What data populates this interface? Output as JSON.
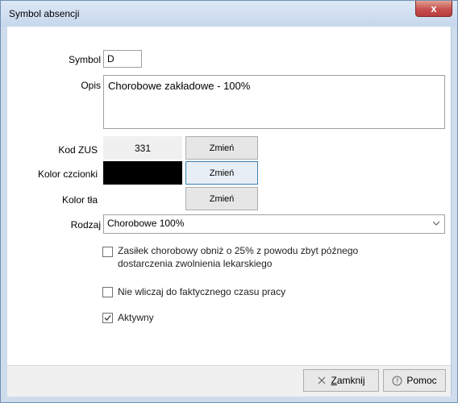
{
  "window": {
    "title": "Symbol absencji",
    "close_glyph": "x"
  },
  "form": {
    "symbol_label": "Symbol",
    "symbol_value": "D",
    "opis_label": "Opis",
    "opis_value": "Chorobowe zakładowe - 100%",
    "kod_zus_label": "Kod ZUS",
    "kod_zus_value": "331",
    "kolor_czcionki_label": "Kolor czcionki",
    "kolor_czcionki_value": "#000000",
    "kolor_tla_label": "Kolor tła",
    "kolor_tla_value": "#ffffff",
    "zmien_label": "Zmień",
    "rodzaj_label": "Rodzaj",
    "rodzaj_value": "Chorobowe 100%"
  },
  "checks": [
    {
      "label_line1": "Zasiłek chorobowy obniż o 25% z powodu zbyt późnego",
      "label_line2": "dostarczenia zwolnienia lekarskiego",
      "checked": false
    },
    {
      "label": "Nie wliczaj do faktycznego czasu pracy",
      "checked": false
    },
    {
      "label": "Aktywny",
      "checked": true
    }
  ],
  "footer": {
    "close_label": "Zamknij",
    "close_mnemonic": "Z",
    "close_rest": "amknij",
    "help_label": "Pomoc"
  },
  "icons": {
    "close": "close-x-icon",
    "help": "help-circle-icon",
    "dropdown": "chevron-down-icon",
    "check": "checkmark-icon"
  }
}
